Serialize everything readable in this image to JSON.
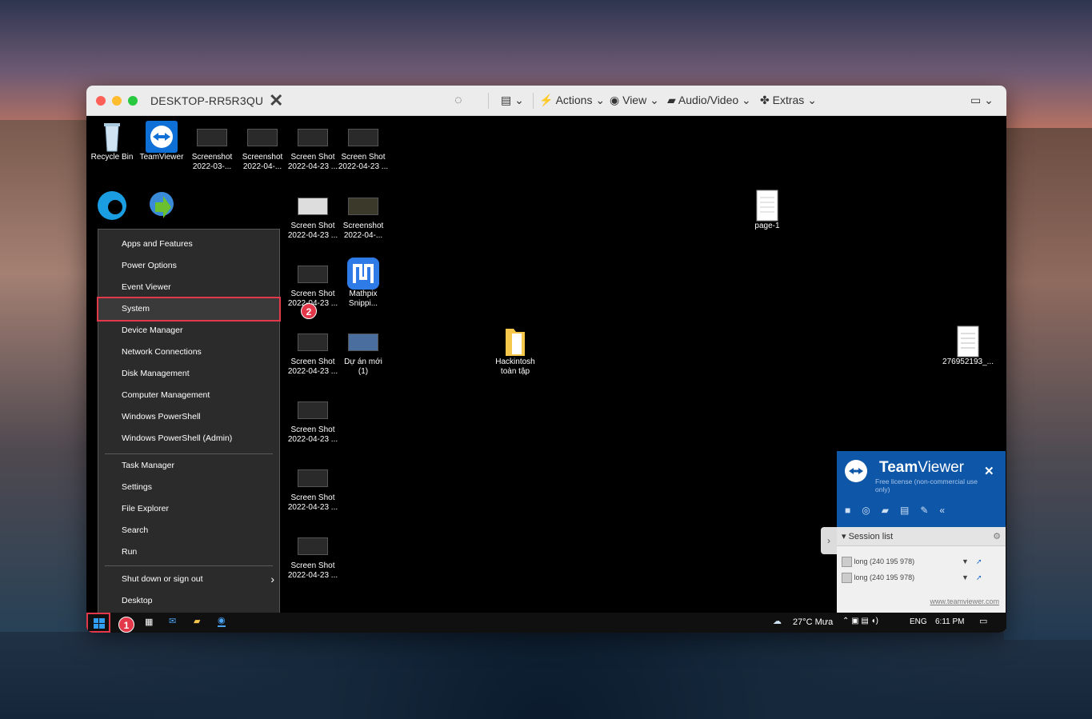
{
  "window": {
    "title": "DESKTOP-RR5R3QU",
    "toolbar": {
      "actions": "Actions",
      "view": "View",
      "audio_video": "Audio/Video",
      "extras": "Extras"
    }
  },
  "desktop_icons": {
    "recycle_bin": "Recycle Bin",
    "teamviewer": "TeamViewer",
    "screenshot_1": [
      "Screenshot",
      "2022-03-..."
    ],
    "screenshot_2": [
      "Screenshot",
      "2022-04-..."
    ],
    "screenshot_3": [
      "Screen Shot",
      "2022-04-23 ..."
    ],
    "screenshot_4": [
      "Screen Shot",
      "2022-04-23 ..."
    ],
    "screenshot_5": [
      "Screen Shot",
      "2022-04-23 ..."
    ],
    "screenshot_6": [
      "Screenshot",
      "2022-04-..."
    ],
    "screenshot_7": [
      "Screen Shot",
      "2022-04-23 ..."
    ],
    "mathpix": [
      "Mathpix",
      "Snippi..."
    ],
    "screenshot_8": [
      "Screen Shot",
      "2022-04-23 ..."
    ],
    "du_an_moi": [
      "Dự án mới",
      "(1)"
    ],
    "screenshot_9": [
      "Screen Shot",
      "2022-04-23 ..."
    ],
    "screenshot_10": [
      "Screen Shot",
      "2022-04-23 ..."
    ],
    "screenshot_11": [
      "Screen Shot",
      "2022-04-23 ..."
    ],
    "hackintosh": [
      "Hackintosh",
      "toàn tập"
    ],
    "page1": "page-1",
    "file_276": "276952193_..."
  },
  "context_menu": {
    "group1": [
      "Apps and Features",
      "Power Options",
      "Event Viewer",
      "System",
      "Device Manager",
      "Network Connections",
      "Disk Management",
      "Computer Management",
      "Windows PowerShell",
      "Windows PowerShell (Admin)"
    ],
    "group2": [
      "Task Manager",
      "Settings",
      "File Explorer",
      "Search",
      "Run"
    ],
    "group3": [
      "Shut down or sign out",
      "Desktop"
    ],
    "selected": "System"
  },
  "badges": {
    "step1": "1",
    "step2": "2"
  },
  "taskbar": {
    "weather": "27°C  Mưa",
    "language": "ENG",
    "time": "6:11 PM"
  },
  "teamviewer_panel": {
    "brand_bold": "Team",
    "brand_light": "Viewer",
    "license": "Free license (non-commercial use only)",
    "session_list": "Session list",
    "sessions": [
      "long (240 195 978)",
      "long (240 195 978)"
    ],
    "link": "www.teamviewer.com"
  },
  "colors": {
    "highlight": "#e3384a",
    "tv_blue": "#0e56a8"
  }
}
